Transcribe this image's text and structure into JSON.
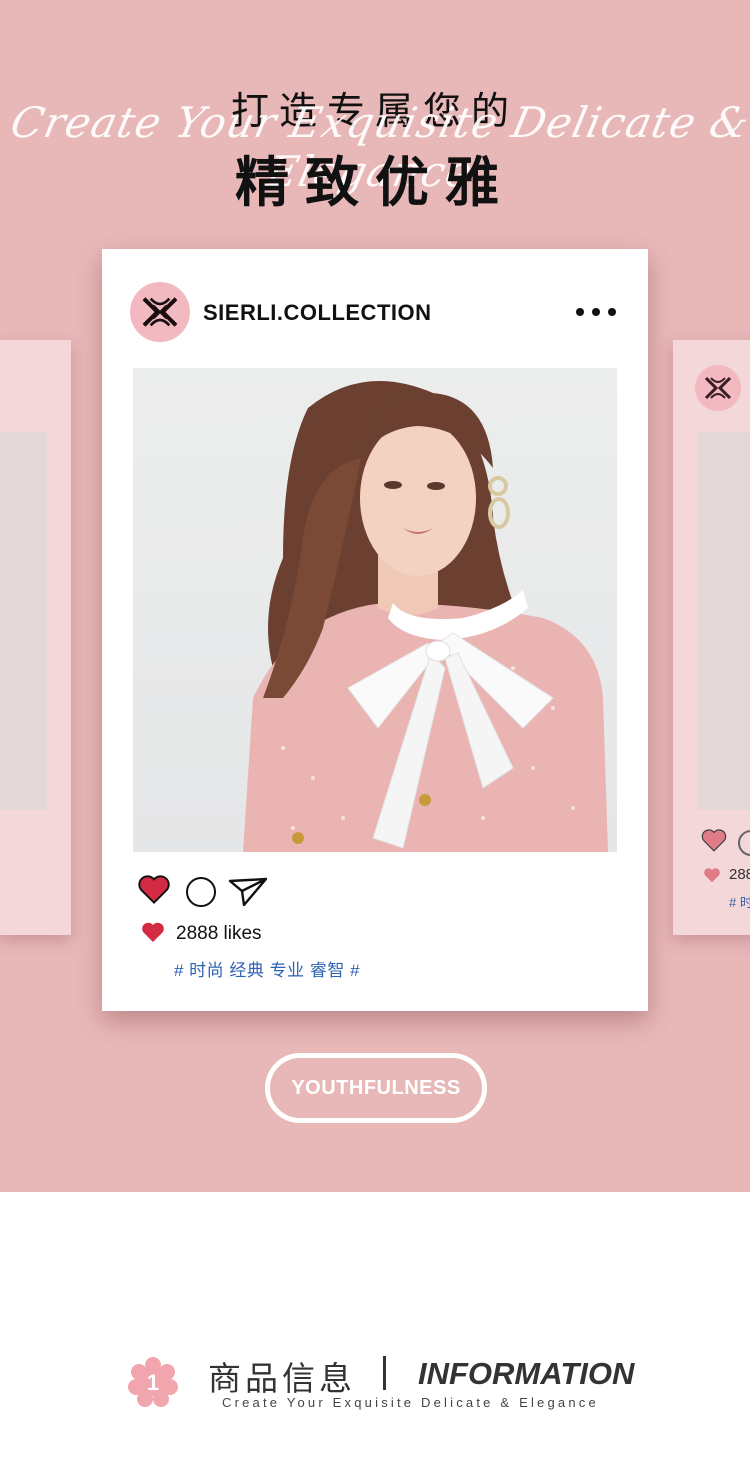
{
  "header": {
    "headline_line1": "打造专属您的",
    "script_text": "Create Your Exquisite Delicate & Elegance",
    "headline_line2": "精致优雅"
  },
  "post": {
    "account_name": "SIERLI.COLLECTION",
    "likes_text": "2888 likes",
    "hashtags": "# 时尚 经典 专业 睿智 #"
  },
  "side_card_right": {
    "likes_text": "288",
    "hashtag_text": "# 时"
  },
  "badge_button": {
    "label": "YOUTHFULNESS"
  },
  "section": {
    "number": "1",
    "title_cn": "商品信息",
    "title_en": "INFORMATION",
    "subtitle": "Create Your Exquisite Delicate & Elegance"
  },
  "colors": {
    "background_pink": "#e8b7b8",
    "card_pink": "#f4d7d9",
    "logo_pink": "#f2b9c1",
    "heart_red": "#d42b45",
    "hashtag_blue": "#2f63b5"
  },
  "icons": [
    "brand-logo-icon",
    "more-options-icon",
    "heart-icon",
    "comment-icon",
    "share-icon",
    "flower-badge-icon"
  ]
}
